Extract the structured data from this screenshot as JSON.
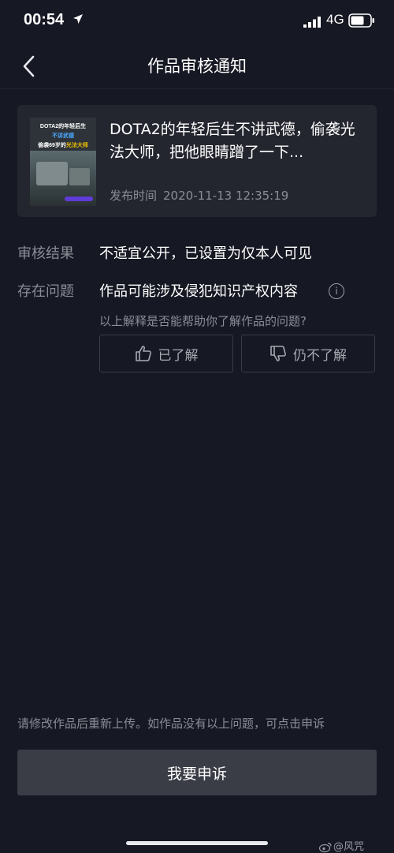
{
  "status_bar": {
    "time": "00:54",
    "network": "4G"
  },
  "nav": {
    "title": "作品审核通知"
  },
  "video": {
    "thumb_line1": "DOTA2的年轻后生",
    "thumb_line2": "不讲武德",
    "thumb_line3a": "偷袭69岁的",
    "thumb_line3b": "光法大师",
    "title": "DOTA2的年轻后生不讲武德，偷袭光法大师，把他眼睛蹭了一下...",
    "publish_label": "发布时间",
    "publish_time": "2020-11-13 12:35:19"
  },
  "review": {
    "result_label": "审核结果",
    "result_value": "不适宜公开，已设置为仅本人可见",
    "issue_label": "存在问题",
    "issue_value": "作品可能涉及侵犯知识产权内容"
  },
  "feedback": {
    "question": "以上解释是否能帮助你了解作品的问题?",
    "understood": "已了解",
    "not_understood": "仍不了解"
  },
  "footer": {
    "tip": "请修改作品后重新上传。如作品没有以上问题，可点击申诉",
    "appeal_button": "我要申诉",
    "watermark": "@风咒"
  },
  "colors": {
    "background": "#161823",
    "card": "#24262f",
    "button": "#3a3c46"
  },
  "icons": [
    "location-icon",
    "signal-icon",
    "battery-icon",
    "back-icon",
    "info-icon",
    "thumbs-up-icon",
    "thumbs-down-icon",
    "weibo-icon"
  ]
}
